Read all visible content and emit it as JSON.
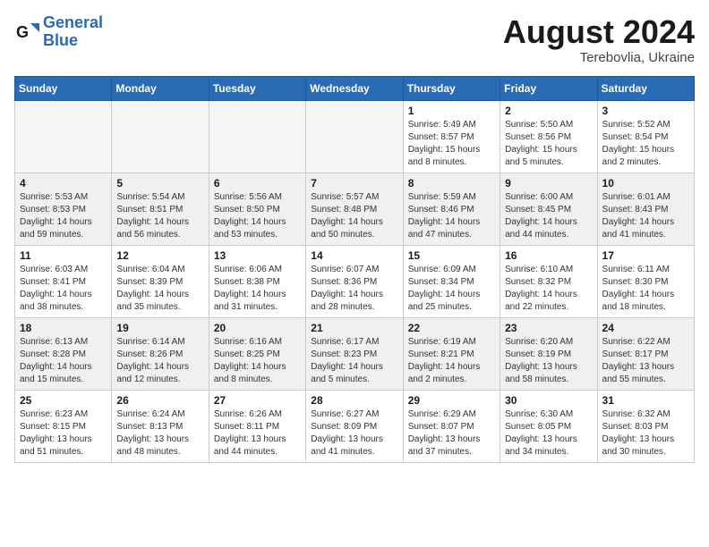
{
  "header": {
    "logo_general": "General",
    "logo_blue": "Blue",
    "month_year": "August 2024",
    "location": "Terebovlia, Ukraine"
  },
  "weekdays": [
    "Sunday",
    "Monday",
    "Tuesday",
    "Wednesday",
    "Thursday",
    "Friday",
    "Saturday"
  ],
  "weeks": [
    [
      {
        "day": "",
        "info": ""
      },
      {
        "day": "",
        "info": ""
      },
      {
        "day": "",
        "info": ""
      },
      {
        "day": "",
        "info": ""
      },
      {
        "day": "1",
        "info": "Sunrise: 5:49 AM\nSunset: 8:57 PM\nDaylight: 15 hours\nand 8 minutes."
      },
      {
        "day": "2",
        "info": "Sunrise: 5:50 AM\nSunset: 8:56 PM\nDaylight: 15 hours\nand 5 minutes."
      },
      {
        "day": "3",
        "info": "Sunrise: 5:52 AM\nSunset: 8:54 PM\nDaylight: 15 hours\nand 2 minutes."
      }
    ],
    [
      {
        "day": "4",
        "info": "Sunrise: 5:53 AM\nSunset: 8:53 PM\nDaylight: 14 hours\nand 59 minutes."
      },
      {
        "day": "5",
        "info": "Sunrise: 5:54 AM\nSunset: 8:51 PM\nDaylight: 14 hours\nand 56 minutes."
      },
      {
        "day": "6",
        "info": "Sunrise: 5:56 AM\nSunset: 8:50 PM\nDaylight: 14 hours\nand 53 minutes."
      },
      {
        "day": "7",
        "info": "Sunrise: 5:57 AM\nSunset: 8:48 PM\nDaylight: 14 hours\nand 50 minutes."
      },
      {
        "day": "8",
        "info": "Sunrise: 5:59 AM\nSunset: 8:46 PM\nDaylight: 14 hours\nand 47 minutes."
      },
      {
        "day": "9",
        "info": "Sunrise: 6:00 AM\nSunset: 8:45 PM\nDaylight: 14 hours\nand 44 minutes."
      },
      {
        "day": "10",
        "info": "Sunrise: 6:01 AM\nSunset: 8:43 PM\nDaylight: 14 hours\nand 41 minutes."
      }
    ],
    [
      {
        "day": "11",
        "info": "Sunrise: 6:03 AM\nSunset: 8:41 PM\nDaylight: 14 hours\nand 38 minutes."
      },
      {
        "day": "12",
        "info": "Sunrise: 6:04 AM\nSunset: 8:39 PM\nDaylight: 14 hours\nand 35 minutes."
      },
      {
        "day": "13",
        "info": "Sunrise: 6:06 AM\nSunset: 8:38 PM\nDaylight: 14 hours\nand 31 minutes."
      },
      {
        "day": "14",
        "info": "Sunrise: 6:07 AM\nSunset: 8:36 PM\nDaylight: 14 hours\nand 28 minutes."
      },
      {
        "day": "15",
        "info": "Sunrise: 6:09 AM\nSunset: 8:34 PM\nDaylight: 14 hours\nand 25 minutes."
      },
      {
        "day": "16",
        "info": "Sunrise: 6:10 AM\nSunset: 8:32 PM\nDaylight: 14 hours\nand 22 minutes."
      },
      {
        "day": "17",
        "info": "Sunrise: 6:11 AM\nSunset: 8:30 PM\nDaylight: 14 hours\nand 18 minutes."
      }
    ],
    [
      {
        "day": "18",
        "info": "Sunrise: 6:13 AM\nSunset: 8:28 PM\nDaylight: 14 hours\nand 15 minutes."
      },
      {
        "day": "19",
        "info": "Sunrise: 6:14 AM\nSunset: 8:26 PM\nDaylight: 14 hours\nand 12 minutes."
      },
      {
        "day": "20",
        "info": "Sunrise: 6:16 AM\nSunset: 8:25 PM\nDaylight: 14 hours\nand 8 minutes."
      },
      {
        "day": "21",
        "info": "Sunrise: 6:17 AM\nSunset: 8:23 PM\nDaylight: 14 hours\nand 5 minutes."
      },
      {
        "day": "22",
        "info": "Sunrise: 6:19 AM\nSunset: 8:21 PM\nDaylight: 14 hours\nand 2 minutes."
      },
      {
        "day": "23",
        "info": "Sunrise: 6:20 AM\nSunset: 8:19 PM\nDaylight: 13 hours\nand 58 minutes."
      },
      {
        "day": "24",
        "info": "Sunrise: 6:22 AM\nSunset: 8:17 PM\nDaylight: 13 hours\nand 55 minutes."
      }
    ],
    [
      {
        "day": "25",
        "info": "Sunrise: 6:23 AM\nSunset: 8:15 PM\nDaylight: 13 hours\nand 51 minutes."
      },
      {
        "day": "26",
        "info": "Sunrise: 6:24 AM\nSunset: 8:13 PM\nDaylight: 13 hours\nand 48 minutes."
      },
      {
        "day": "27",
        "info": "Sunrise: 6:26 AM\nSunset: 8:11 PM\nDaylight: 13 hours\nand 44 minutes."
      },
      {
        "day": "28",
        "info": "Sunrise: 6:27 AM\nSunset: 8:09 PM\nDaylight: 13 hours\nand 41 minutes."
      },
      {
        "day": "29",
        "info": "Sunrise: 6:29 AM\nSunset: 8:07 PM\nDaylight: 13 hours\nand 37 minutes."
      },
      {
        "day": "30",
        "info": "Sunrise: 6:30 AM\nSunset: 8:05 PM\nDaylight: 13 hours\nand 34 minutes."
      },
      {
        "day": "31",
        "info": "Sunrise: 6:32 AM\nSunset: 8:03 PM\nDaylight: 13 hours\nand 30 minutes."
      }
    ]
  ]
}
